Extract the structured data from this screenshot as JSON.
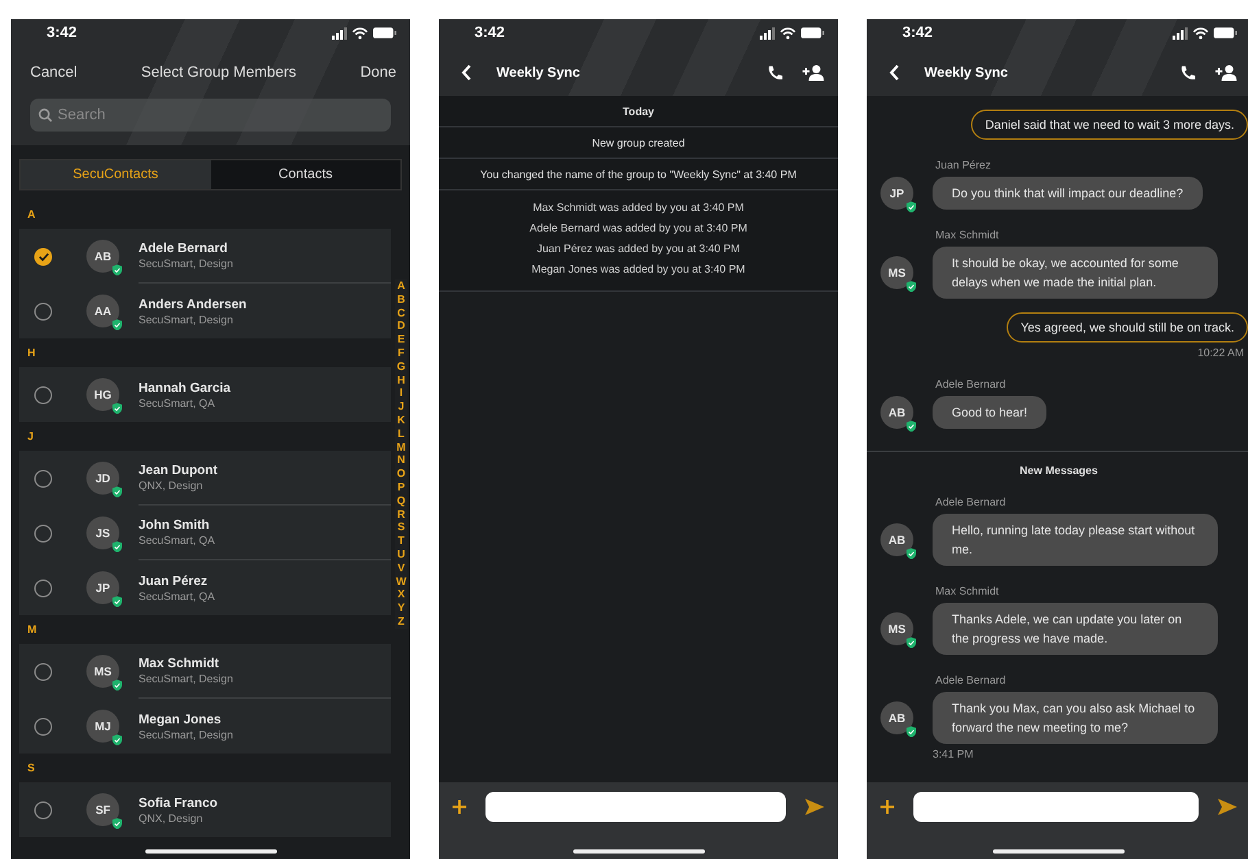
{
  "screens": [
    {
      "kind": "contacts",
      "status_time": "3:42",
      "cancel": "Cancel",
      "title": "Select Group Members",
      "done": "Done",
      "search": {
        "placeholder": "Search"
      },
      "tabs": [
        {
          "label": "SecuContacts",
          "selected": true
        },
        {
          "label": "Contacts",
          "selected": false
        }
      ],
      "sections": [
        {
          "letter": "A",
          "contacts": [
            {
              "initials": "AB",
              "name": "Adele Bernard",
              "detail": "SecuSmart, Design",
              "checked": true
            },
            {
              "initials": "AA",
              "name": "Anders Andersen",
              "detail": "SecuSmart, Design",
              "checked": false
            }
          ]
        },
        {
          "letter": "H",
          "contacts": [
            {
              "initials": "HG",
              "name": "Hannah Garcia",
              "detail": "SecuSmart, QA",
              "checked": false
            }
          ]
        },
        {
          "letter": "J",
          "contacts": [
            {
              "initials": "JD",
              "name": "Jean Dupont",
              "detail": "QNX, Design",
              "checked": false
            },
            {
              "initials": "JS",
              "name": "John Smith",
              "detail": "SecuSmart, QA",
              "checked": false
            },
            {
              "initials": "JP",
              "name": "Juan Pérez",
              "detail": "SecuSmart, QA",
              "checked": false
            }
          ]
        },
        {
          "letter": "M",
          "contacts": [
            {
              "initials": "MS",
              "name": "Max Schmidt",
              "detail": "SecuSmart, Design",
              "checked": false
            },
            {
              "initials": "MJ",
              "name": "Megan Jones",
              "detail": "SecuSmart, Design",
              "checked": false
            }
          ]
        },
        {
          "letter": "S",
          "contacts": [
            {
              "initials": "SF",
              "name": "Sofia Franco",
              "detail": "QNX, Design",
              "checked": false
            }
          ]
        }
      ],
      "index_letters": [
        "A",
        "B",
        "C",
        "D",
        "E",
        "F",
        "G",
        "H",
        "I",
        "J",
        "K",
        "L",
        "M",
        "N",
        "O",
        "P",
        "Q",
        "R",
        "S",
        "T",
        "U",
        "V",
        "W",
        "X",
        "Y",
        "Z"
      ]
    },
    {
      "kind": "chat",
      "status_time": "3:42",
      "title": "Weekly Sync",
      "items": [
        {
          "kind": "date",
          "text": "Today"
        },
        {
          "kind": "notice",
          "text": "New group created"
        },
        {
          "kind": "notice",
          "text": "You changed the name of the group to \"Weekly Sync\" at 3:40 PM"
        },
        {
          "kind": "notice_group",
          "lines": [
            "Max Schmidt was added by you at 3:40 PM",
            "Adele Bernard was added by you at 3:40 PM",
            "Juan Pérez was added by you at 3:40 PM",
            "Megan Jones was added by you at 3:40 PM"
          ]
        }
      ]
    },
    {
      "kind": "chat",
      "status_time": "3:42",
      "title": "Weekly Sync",
      "items": [
        {
          "kind": "outgoing",
          "text": "Daniel said that we need to wait 3 more days."
        },
        {
          "kind": "incoming",
          "sender": "Juan Pérez",
          "initials": "JP",
          "text": "Do you think that will impact our deadline?"
        },
        {
          "kind": "incoming",
          "sender": "Max Schmidt",
          "initials": "MS",
          "text": "It should be okay, we accounted for some delays when we made the initial plan."
        },
        {
          "kind": "outgoing",
          "text": "Yes agreed, we should still be on track.",
          "time": "10:22 AM"
        },
        {
          "kind": "incoming",
          "sender": "Adele Bernard",
          "initials": "AB",
          "text": "Good to hear!"
        },
        {
          "kind": "divider",
          "text": "New Messages"
        },
        {
          "kind": "incoming",
          "sender": "Adele Bernard",
          "initials": "AB",
          "text": "Hello, running late today please start without me."
        },
        {
          "kind": "incoming",
          "sender": "Max Schmidt",
          "initials": "MS",
          "text": "Thanks Adele, we can update you later on the progress we have made."
        },
        {
          "kind": "incoming",
          "sender": "Adele Bernard",
          "initials": "AB",
          "text": "Thank you Max, can you also ask Michael to forward the new meeting to me?",
          "time": "3:41 PM"
        }
      ]
    }
  ]
}
